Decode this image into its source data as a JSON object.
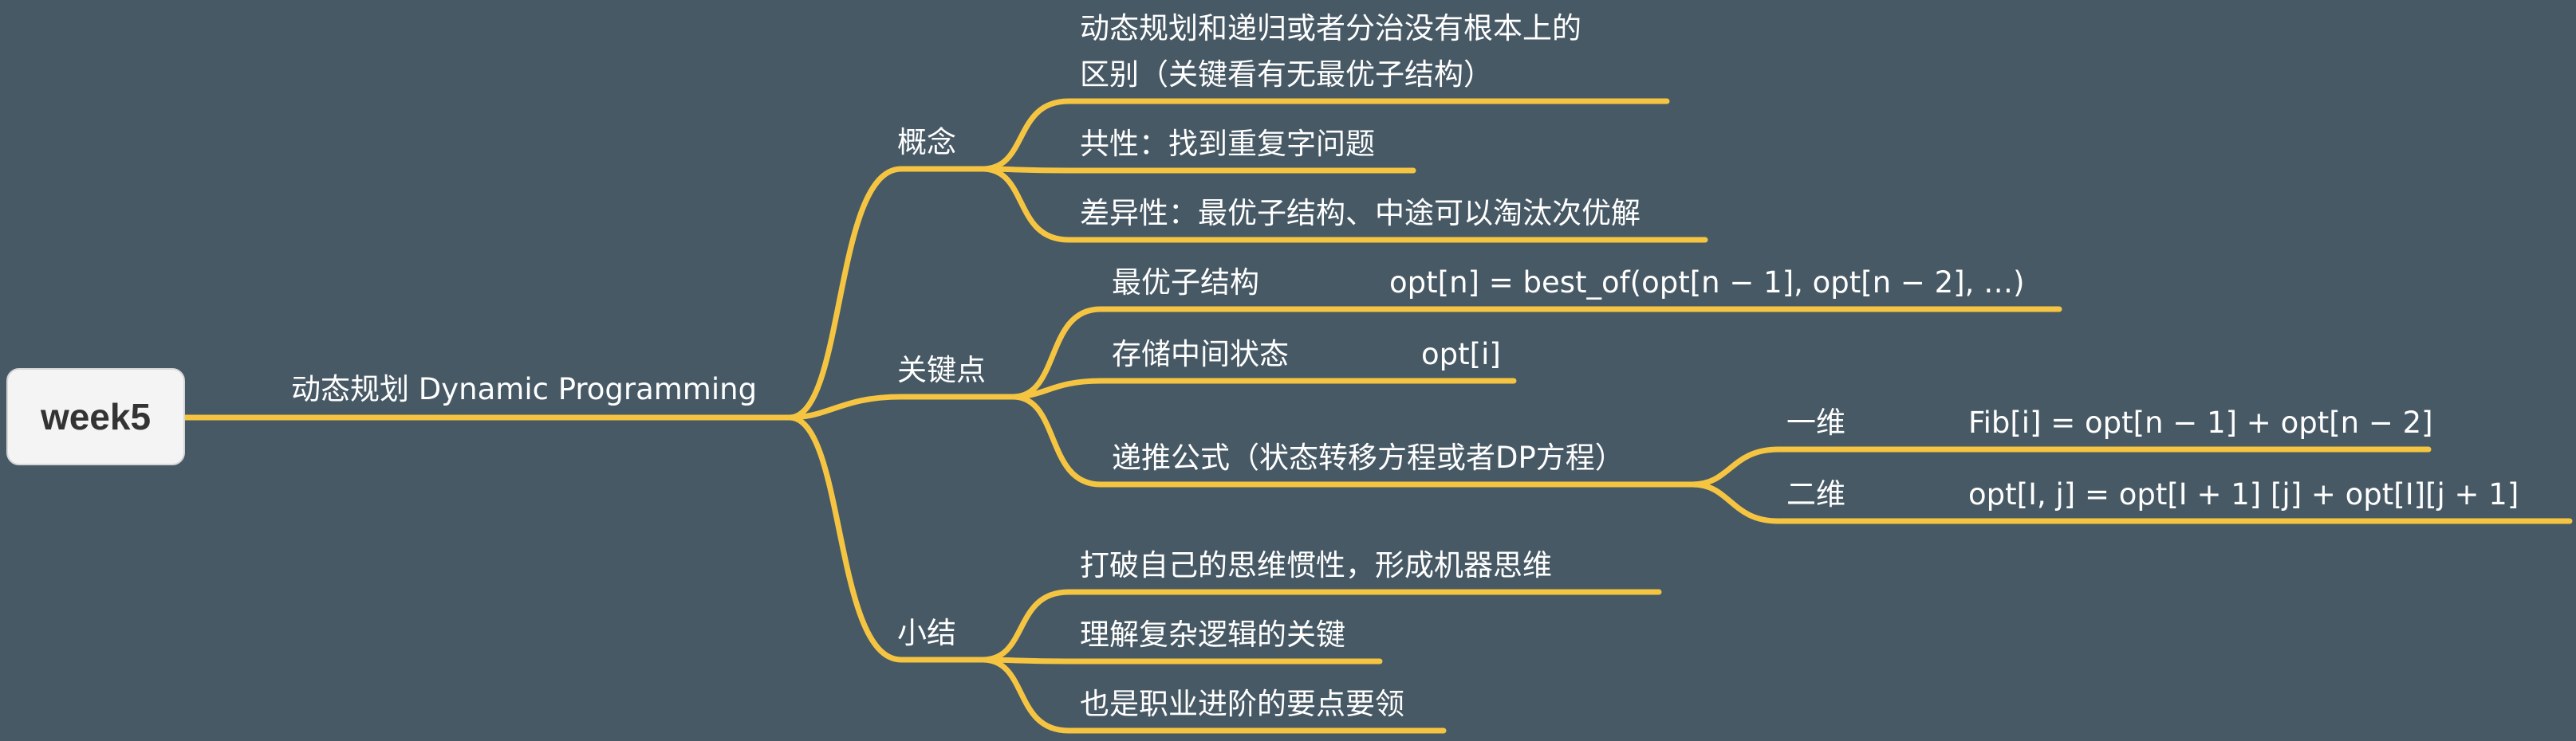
{
  "root": {
    "label": "week5"
  },
  "level1": {
    "label": "动态规划 Dynamic Programming"
  },
  "concepts": {
    "label": "概念",
    "items": [
      {
        "line1": "动态规划和递归或者分治没有根本上的",
        "line2": "区别（关键看有无最优子结构）"
      },
      {
        "text": "共性：找到重复字问题"
      },
      {
        "text": "差异性：最优子结构、中途可以淘汰次优解"
      }
    ]
  },
  "keypoints": {
    "label": "关键点",
    "items": [
      {
        "text": "最优子结构",
        "formula": "opt[n] = best_of(opt[n − 1], opt[n − 2], …)"
      },
      {
        "text": "存储中间状态",
        "formula": "opt[i]"
      },
      {
        "text": "递推公式（状态转移方程或者DP方程）",
        "children": [
          {
            "label": "一维",
            "formula": "Fib[i] = opt[n − 1] + opt[n − 2]"
          },
          {
            "label": "二维",
            "formula": "opt[I, j] = opt[I + 1] [j] + opt[I][j + 1]"
          }
        ]
      }
    ]
  },
  "summary": {
    "label": "小结",
    "items": [
      {
        "text": "打破自己的思维惯性，形成机器思维"
      },
      {
        "text": "理解复杂逻辑的关键"
      },
      {
        "text": "也是职业进阶的要点要领"
      }
    ]
  }
}
